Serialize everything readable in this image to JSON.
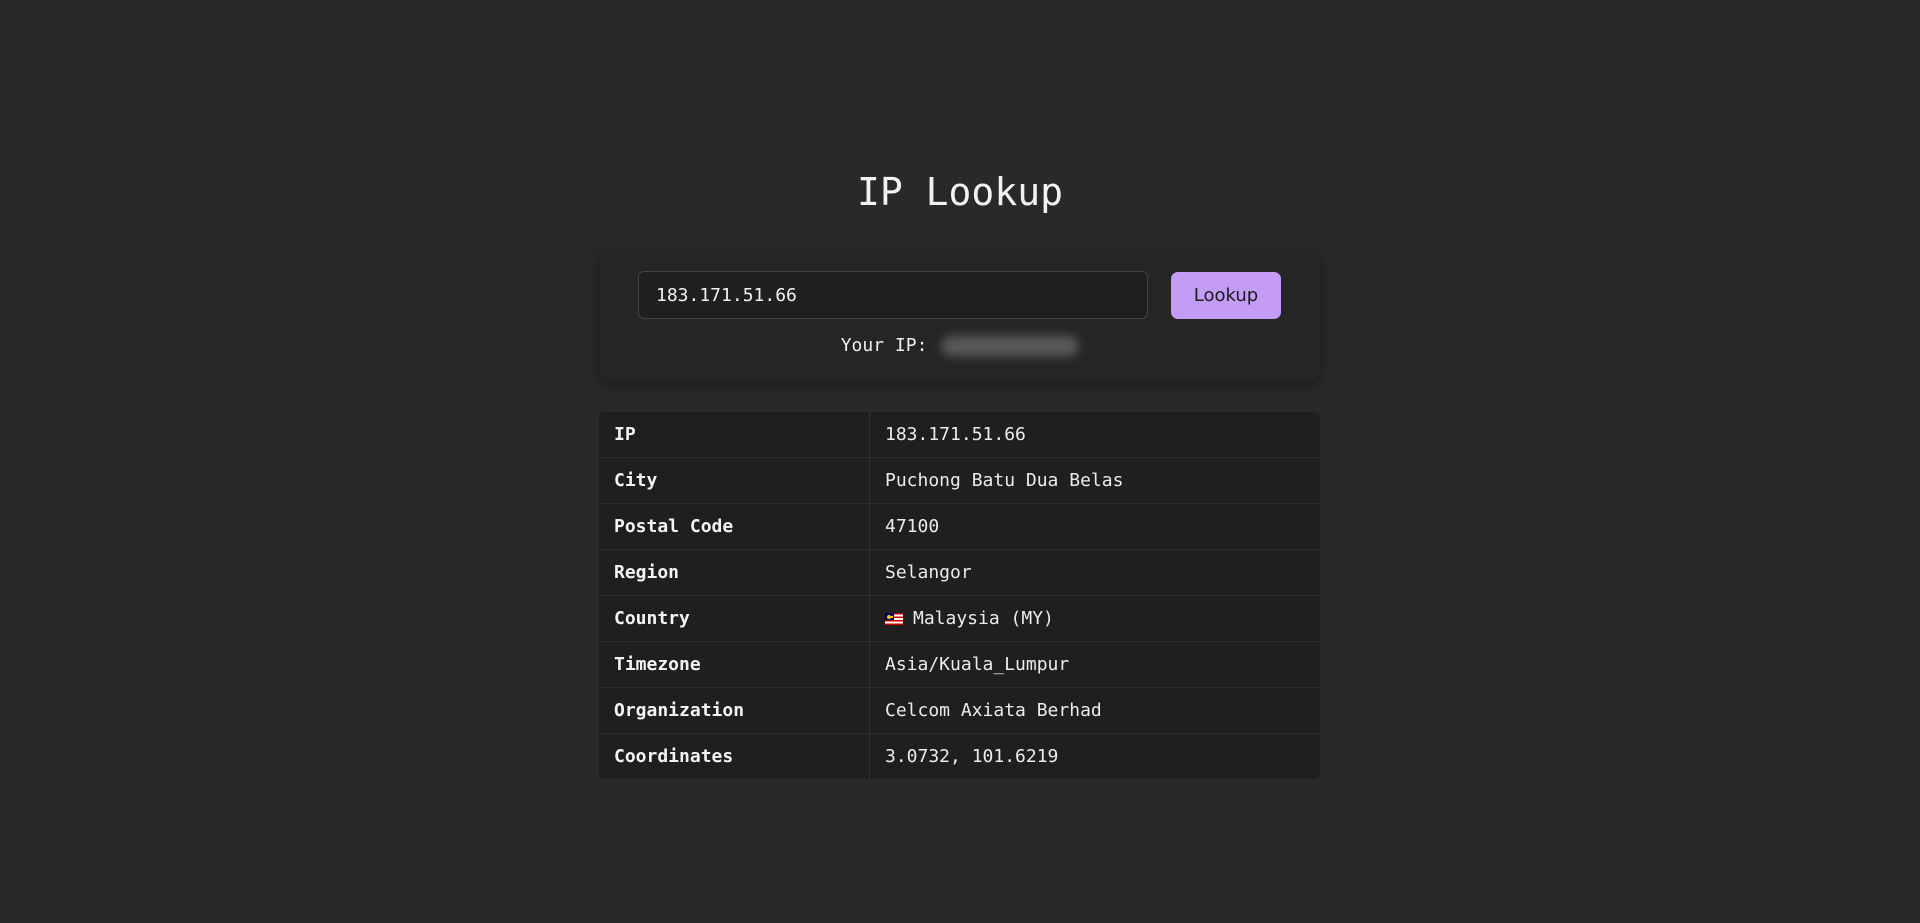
{
  "header": {
    "title": "IP Lookup"
  },
  "search": {
    "input_value": "183.171.51.66",
    "button_label": "Lookup",
    "your_ip_label": "Your IP:"
  },
  "results": {
    "rows": [
      {
        "key": "IP",
        "value": "183.171.51.66"
      },
      {
        "key": "City",
        "value": "Puchong Batu Dua Belas"
      },
      {
        "key": "Postal Code",
        "value": "47100"
      },
      {
        "key": "Region",
        "value": "Selangor"
      },
      {
        "key": "Country",
        "value": "Malaysia (MY)",
        "icon": "malaysia-flag-icon"
      },
      {
        "key": "Timezone",
        "value": "Asia/Kuala_Lumpur"
      },
      {
        "key": "Organization",
        "value": "Celcom Axiata Berhad"
      },
      {
        "key": "Coordinates",
        "value": "3.0732, 101.6219"
      }
    ]
  },
  "colors": {
    "background": "#292929",
    "card": "#252525",
    "table": "#1f1f1f",
    "accent": "#c39cf5",
    "text": "#f0f0f0"
  }
}
